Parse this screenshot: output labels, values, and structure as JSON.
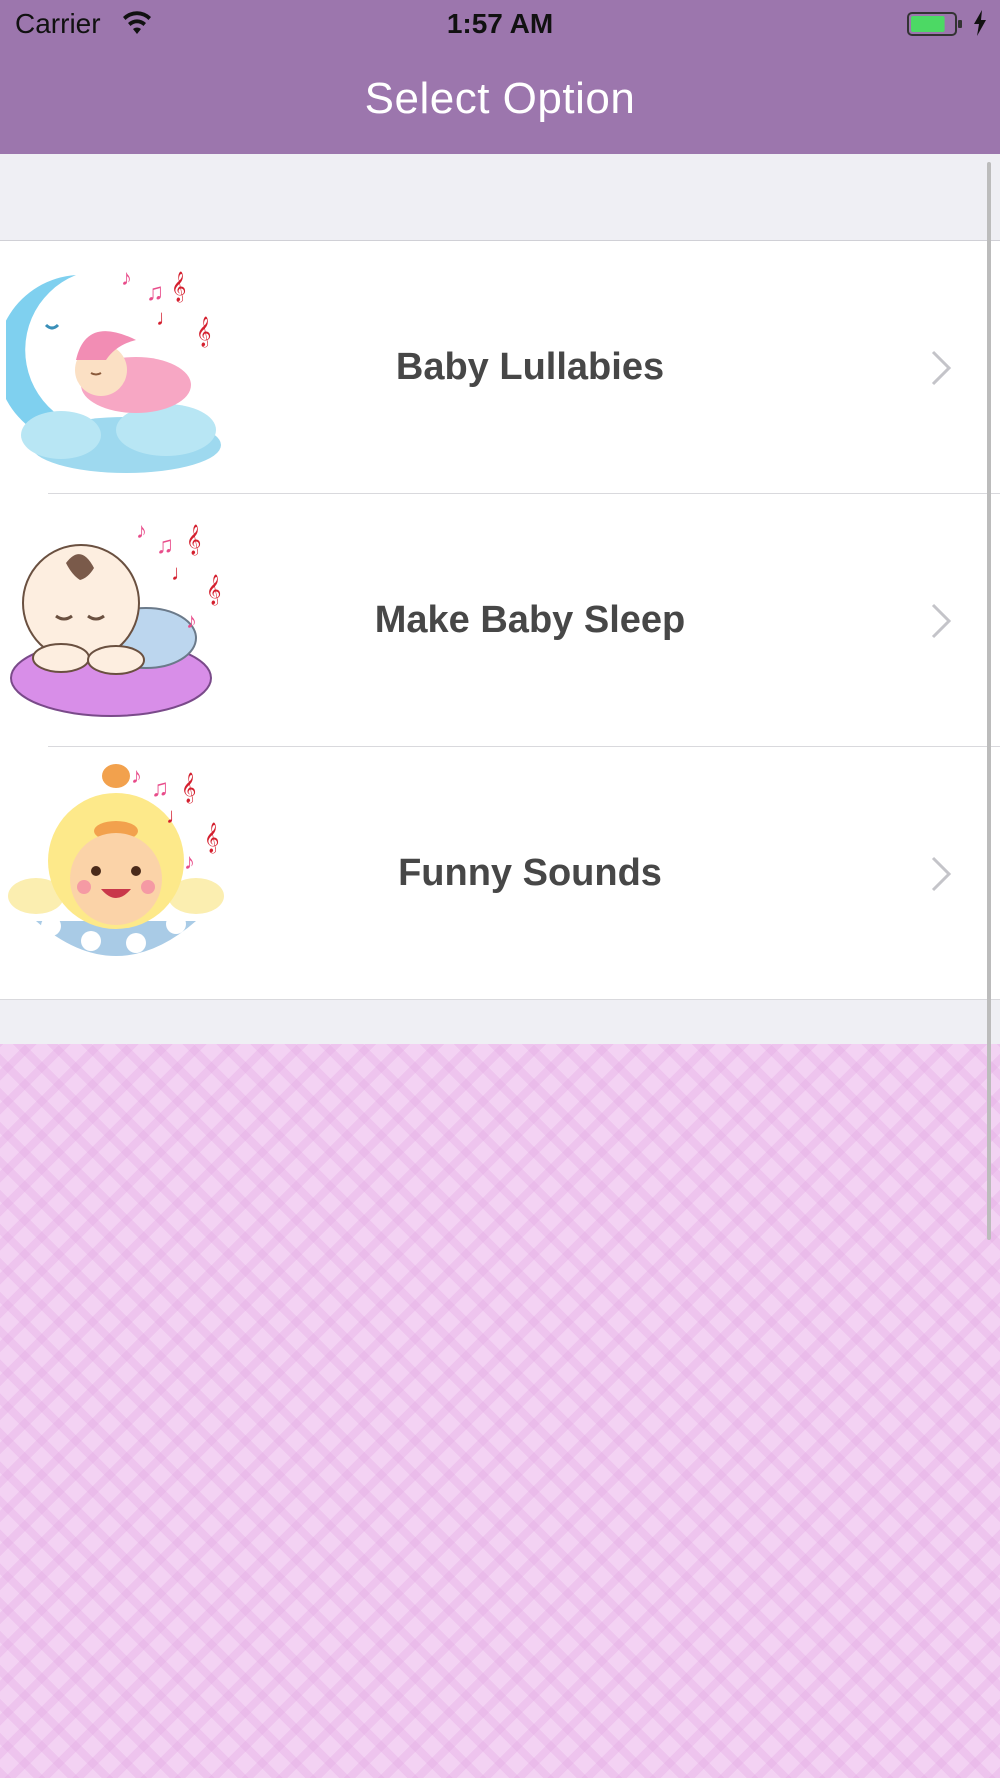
{
  "status_bar": {
    "carrier": "Carrier",
    "time": "1:57 AM",
    "battery_level": 0.8,
    "battery_color": "#4cd964"
  },
  "nav": {
    "title": "Select Option",
    "background": "#9c76ad"
  },
  "options": [
    {
      "label": "Baby Lullabies",
      "icon": "sleeping-baby-on-moon-icon"
    },
    {
      "label": "Make Baby Sleep",
      "icon": "baby-on-cloud-icon"
    },
    {
      "label": "Funny Sounds",
      "icon": "chick-baby-in-egg-icon"
    }
  ]
}
